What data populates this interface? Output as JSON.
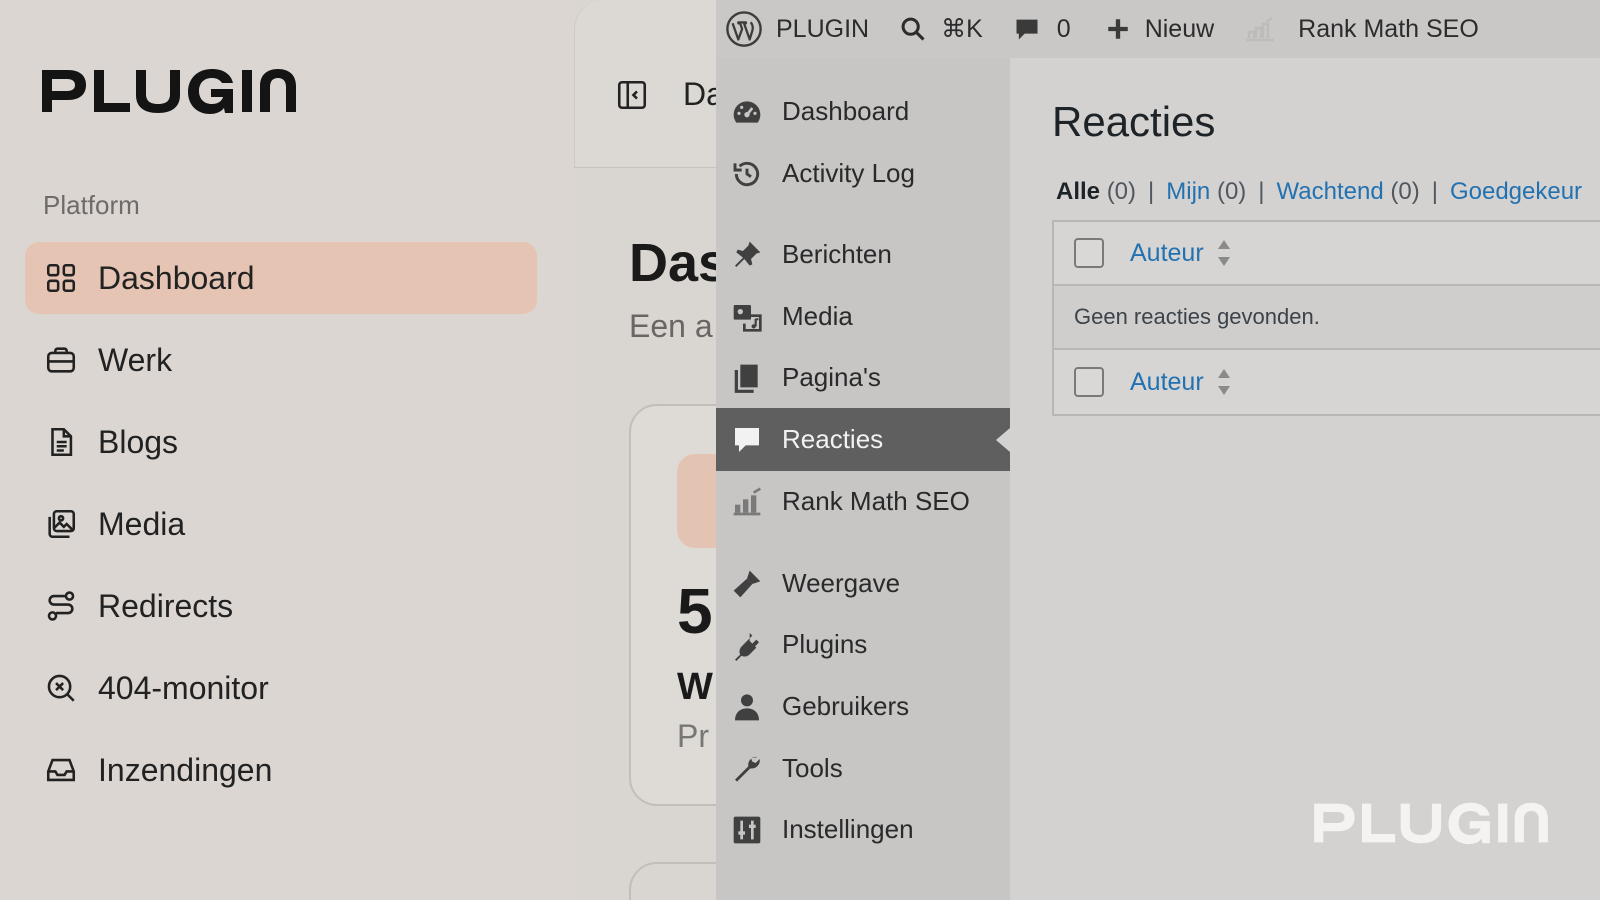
{
  "app": {
    "logo_text": "PLUGIN",
    "section_label": "Platform",
    "nav": [
      {
        "label": "Dashboard",
        "icon": "grid-icon",
        "active": true
      },
      {
        "label": "Werk",
        "icon": "briefcase-icon"
      },
      {
        "label": "Blogs",
        "icon": "document-icon"
      },
      {
        "label": "Media",
        "icon": "images-icon"
      },
      {
        "label": "Redirects",
        "icon": "redirect-icon"
      },
      {
        "label": "404-monitor",
        "icon": "search-x-icon"
      },
      {
        "label": "Inzendingen",
        "icon": "inbox-icon"
      }
    ],
    "main": {
      "breadcrumb": "Da",
      "title": "Das",
      "subtitle": "Een a",
      "card": {
        "value": "5",
        "title": "W",
        "subtitle": "Pr"
      }
    },
    "colors": {
      "active_nav": "#e5c4b3"
    }
  },
  "wp": {
    "adminbar": {
      "site": "PLUGIN",
      "search_shortcut": "⌘K",
      "comments_count": "0",
      "new_label": "Nieuw",
      "rankmath_label": "Rank Math SEO"
    },
    "menu": [
      {
        "label": "Dashboard",
        "icon": "gauge-icon"
      },
      {
        "label": "Activity Log",
        "icon": "history-icon"
      },
      {
        "label": "Berichten",
        "icon": "pin-icon"
      },
      {
        "label": "Media",
        "icon": "media-icon"
      },
      {
        "label": "Pagina's",
        "icon": "pages-icon"
      },
      {
        "label": "Reacties",
        "icon": "comment-icon",
        "current": true
      },
      {
        "label": "Rank Math SEO",
        "icon": "rankmath-icon"
      },
      {
        "label": "Weergave",
        "icon": "brush-icon"
      },
      {
        "label": "Plugins",
        "icon": "plug-icon"
      },
      {
        "label": "Gebruikers",
        "icon": "user-icon"
      },
      {
        "label": "Tools",
        "icon": "wrench-icon"
      },
      {
        "label": "Instellingen",
        "icon": "settings-icon"
      }
    ],
    "page_title": "Reacties",
    "filters": [
      {
        "label": "Alle",
        "count": "(0)",
        "current": true
      },
      {
        "label": "Mijn",
        "count": "(0)"
      },
      {
        "label": "Wachtend",
        "count": "(0)"
      },
      {
        "label": "Goedgekeur",
        "count": ""
      }
    ],
    "table": {
      "column_author": "Auteur",
      "empty_message": "Geen reacties gevonden."
    },
    "colors": {
      "link": "#2271b1",
      "menu_current": "#5f5f5f"
    }
  },
  "watermark_text": "PLUGIN"
}
